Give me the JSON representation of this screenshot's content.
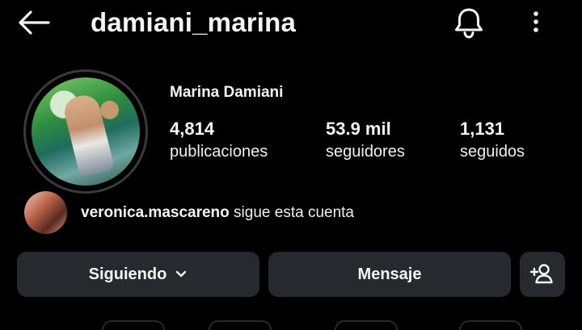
{
  "header": {
    "username": "damiani_marina",
    "back_icon": "arrow-left-icon",
    "notifications_icon": "bell-icon",
    "more_icon": "more-vertical-icon"
  },
  "profile": {
    "full_name": "Marina Damiani",
    "avatar_icon": "profile-photo",
    "stats": [
      {
        "value": "4,814",
        "label": "publicaciones"
      },
      {
        "value": "53.9 mil",
        "label": "seguidores"
      },
      {
        "value": "1,131",
        "label": "seguidos"
      }
    ]
  },
  "followed_by": {
    "username": "veronica.mascareno",
    "text": "sigue esta cuenta"
  },
  "actions": {
    "following_label": "Siguiendo",
    "following_icon": "chevron-down-icon",
    "message_label": "Mensaje",
    "add_user_icon": "person-add-icon"
  },
  "colors": {
    "background": "#000000",
    "button": "#26292d",
    "text": "#f5f5f5"
  }
}
